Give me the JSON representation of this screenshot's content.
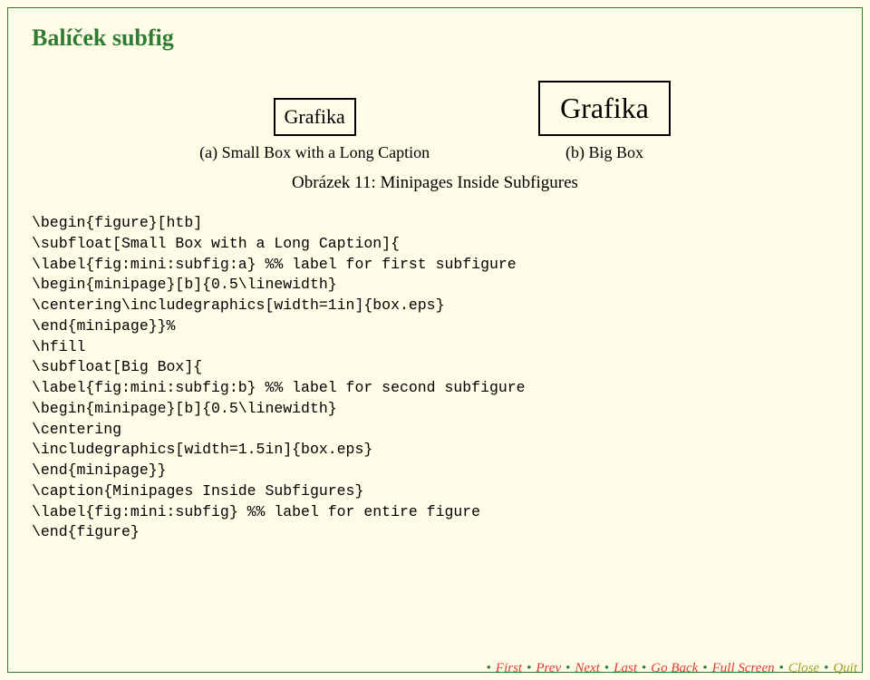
{
  "title": "Balíček subfig",
  "figure": {
    "subfig_a": {
      "box_text": "Grafika",
      "caption": "(a) Small Box with a Long Caption"
    },
    "subfig_b": {
      "box_text": "Grafika",
      "caption": "(b) Big Box"
    },
    "main_caption": "Obrázek 11: Minipages Inside Subfigures"
  },
  "code": "\\begin{figure}[htb]\n\\subfloat[Small Box with a Long Caption]{\n\\label{fig:mini:subfig:a} %% label for first subfigure\n\\begin{minipage}[b]{0.5\\linewidth}\n\\centering\\includegraphics[width=1in]{box.eps}\n\\end{minipage}}%\n\\hfill\n\\subfloat[Big Box]{\n\\label{fig:mini:subfig:b} %% label for second subfigure\n\\begin{minipage}[b]{0.5\\linewidth}\n\\centering\n\\includegraphics[width=1.5in]{box.eps}\n\\end{minipage}}\n\\caption{Minipages Inside Subfigures}\n\\label{fig:mini:subfig} %% label for entire figure\n\\end{figure}",
  "nav": {
    "first": "First",
    "prev": "Prev",
    "next": "Next",
    "last": "Last",
    "goback": "Go Back",
    "fullscreen": "Full Screen",
    "close": "Close",
    "quit": "Quit"
  }
}
